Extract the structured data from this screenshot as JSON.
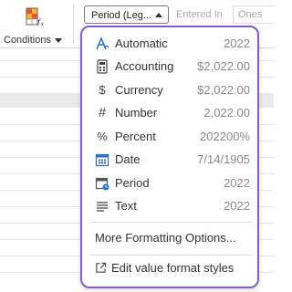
{
  "toolbar": {
    "conditions_label": "Conditions",
    "conditions_icon": "conditional-format-icon",
    "period_select_value": "Period (Leg...",
    "entered_in_label": "Entered In",
    "ones_value": "Ones"
  },
  "format_menu": {
    "items": [
      {
        "icon": "automatic-a-icon",
        "label": "Automatic",
        "value": "2022"
      },
      {
        "icon": "calculator-icon",
        "label": "Accounting",
        "value": "$2,022.00"
      },
      {
        "icon": "dollar-icon",
        "label": "Currency",
        "value": "$2,022.00"
      },
      {
        "icon": "hash-icon",
        "label": "Number",
        "value": "2,022.00"
      },
      {
        "icon": "percent-icon",
        "label": "Percent",
        "value": "202200%"
      },
      {
        "icon": "calendar-icon",
        "label": "Date",
        "value": "7/14/1905"
      },
      {
        "icon": "period-calendar-icon",
        "label": "Period",
        "value": "2022"
      },
      {
        "icon": "text-lines-icon",
        "label": "Text",
        "value": "2022"
      }
    ],
    "more_options_label": "More Formatting Options...",
    "edit_styles_label": "Edit value format styles"
  },
  "colors": {
    "menu_border": "#8a5cc6",
    "icon_blue": "#2b6fd6"
  }
}
